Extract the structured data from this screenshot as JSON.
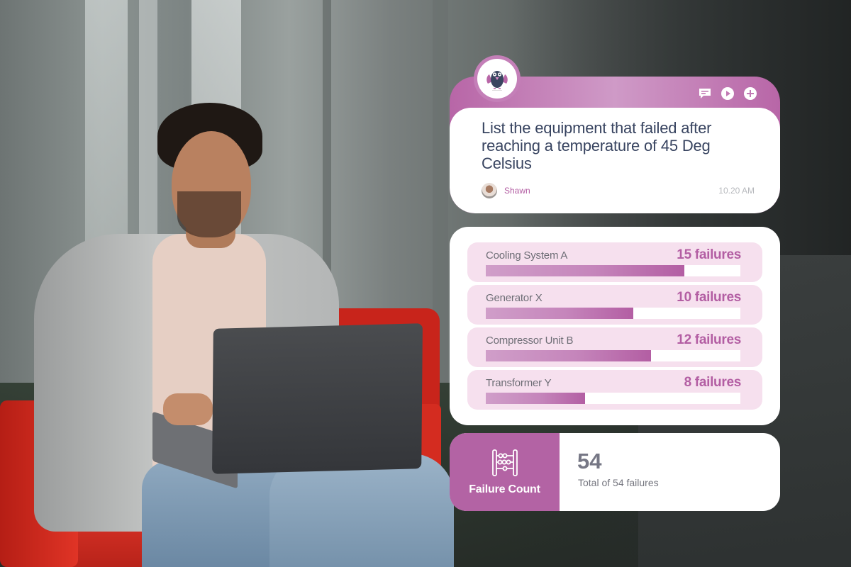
{
  "chat": {
    "question": "List the equipment that failed after reaching a temperature of 45 Deg Celsius",
    "user_name": "Shawn",
    "time": "10.20 AM",
    "icons": [
      "chat-icon",
      "play-icon",
      "plus-icon"
    ],
    "bot_icon": "owl-bot-icon"
  },
  "results": {
    "items": [
      {
        "label": "Cooling System A",
        "value": "15 failures",
        "count": 15,
        "bar_fraction": 0.78
      },
      {
        "label": "Generator X",
        "value": "10 failures",
        "count": 10,
        "bar_fraction": 0.58
      },
      {
        "label": "Compressor Unit B",
        "value": "12 failures",
        "count": 12,
        "bar_fraction": 0.65
      },
      {
        "label": "Transformer Y",
        "value": "8 failures",
        "count": 8,
        "bar_fraction": 0.39
      }
    ]
  },
  "summary": {
    "title": "Failure Count",
    "icon": "abacus-icon",
    "total": "54",
    "description": "Total of 54 failures"
  },
  "colors": {
    "accent": "#b363a4",
    "question_text": "#384460",
    "row_bg": "#f6e0ee"
  }
}
